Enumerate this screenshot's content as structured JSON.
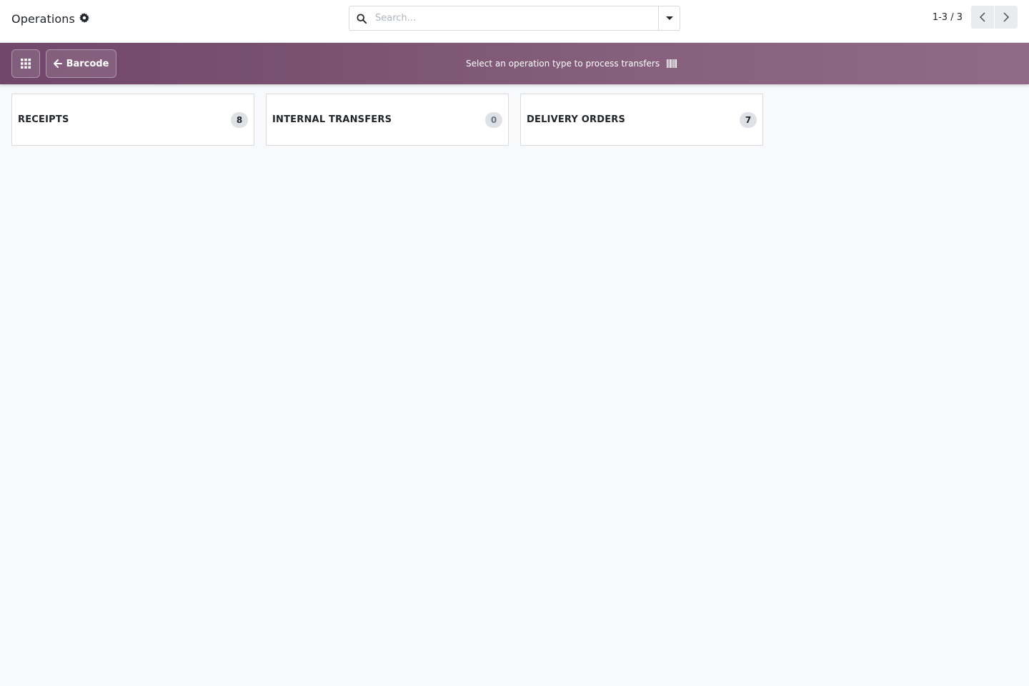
{
  "header": {
    "title": "Operations",
    "search": {
      "placeholder": "Search..."
    },
    "pager": {
      "value": "1-3 / 3"
    }
  },
  "banner": {
    "back_label": "Barcode",
    "message": "Select an operation type to process transfers"
  },
  "operations": [
    {
      "label": "RECEIPTS",
      "count": "8"
    },
    {
      "label": "INTERNAL TRANSFERS",
      "count": "0"
    },
    {
      "label": "DELIVERY ORDERS",
      "count": "7"
    }
  ],
  "icons": [
    "gear-icon",
    "search-icon",
    "caret-down-icon",
    "chevron-left-icon",
    "chevron-right-icon",
    "apps-grid-icon",
    "arrow-left-icon",
    "barcode-icon"
  ],
  "colors": {
    "banner_start": "#71476b",
    "banner_end": "#906a86",
    "background": "#f8f9fa",
    "badge": "#dee2e6"
  }
}
